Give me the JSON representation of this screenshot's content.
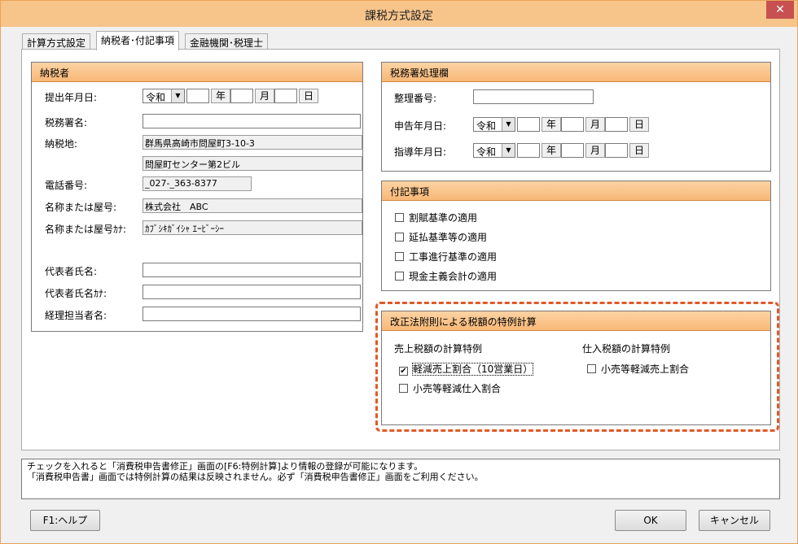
{
  "window": {
    "title": "課税方式設定",
    "close_label": "✕"
  },
  "tabs": [
    {
      "label": "計算方式設定"
    },
    {
      "label": "納税者･付記事項"
    },
    {
      "label": "金融機関･税理士"
    }
  ],
  "taxpayer": {
    "header": "納税者",
    "submission_date_label": "提出年月日:",
    "tax_office_label": "税務署名:",
    "address_label": "納税地:",
    "address_line1": "群馬県高崎市問屋町3-10-3",
    "address_line2": "問屋町センター第2ビル",
    "phone_label": "電話番号:",
    "phone_value": "_027-_363-8377",
    "name_label": "名称または屋号:",
    "name_value": "株式会社　ABC",
    "name_kana_label": "名称または屋号ｶﾅ:",
    "name_kana_value": "ｶﾌﾞｼｷｶﾞｲｼｬ ｴｰﾋﾞｰｼｰ",
    "rep_label": "代表者氏名:",
    "rep_kana_label": "代表者氏名ｶﾅ:",
    "accountant_label": "経理担当者名:"
  },
  "date_units": {
    "era": "令和",
    "year": "年",
    "month": "月",
    "day": "日"
  },
  "tax_office_section": {
    "header": "税務署処理欄",
    "ref_label": "整理番号:",
    "report_date_label": "申告年月日:",
    "guidance_date_label": "指導年月日:"
  },
  "notes": {
    "header": "付記事項",
    "items": [
      {
        "label": "割賦基準の適用",
        "checked": false
      },
      {
        "label": "延払基準等の適用",
        "checked": false
      },
      {
        "label": "工事進行基準の適用",
        "checked": false
      },
      {
        "label": "現金主義会計の適用",
        "checked": false
      }
    ]
  },
  "special": {
    "header": "改正法附則による税額の特例計算",
    "sales_title": "売上税額の計算特例",
    "purchase_title": "仕入税額の計算特例",
    "sales_items": [
      {
        "label": "軽減売上割合（10営業日）",
        "checked": true
      },
      {
        "label": "小売等軽減仕入割合",
        "checked": false
      }
    ],
    "purchase_items": [
      {
        "label": "小売等軽減売上割合",
        "checked": false
      }
    ]
  },
  "message": {
    "line1": "チェックを入れると「消費税申告書修正」画面の[F6:特例計算]より情報の登録が可能になります。",
    "line2": "「消費税申告書」画面では特例計算の結果は反映されません。必ず「消費税申告書修正」画面をご利用ください。"
  },
  "buttons": {
    "help": "F1:ヘルプ",
    "ok": "OK",
    "cancel": "キャンセル"
  },
  "colors": {
    "header_fill": "#f8b877",
    "highlight_border": "#e05a2b",
    "titlebar": "#f7c48a",
    "close": "#c75050"
  }
}
